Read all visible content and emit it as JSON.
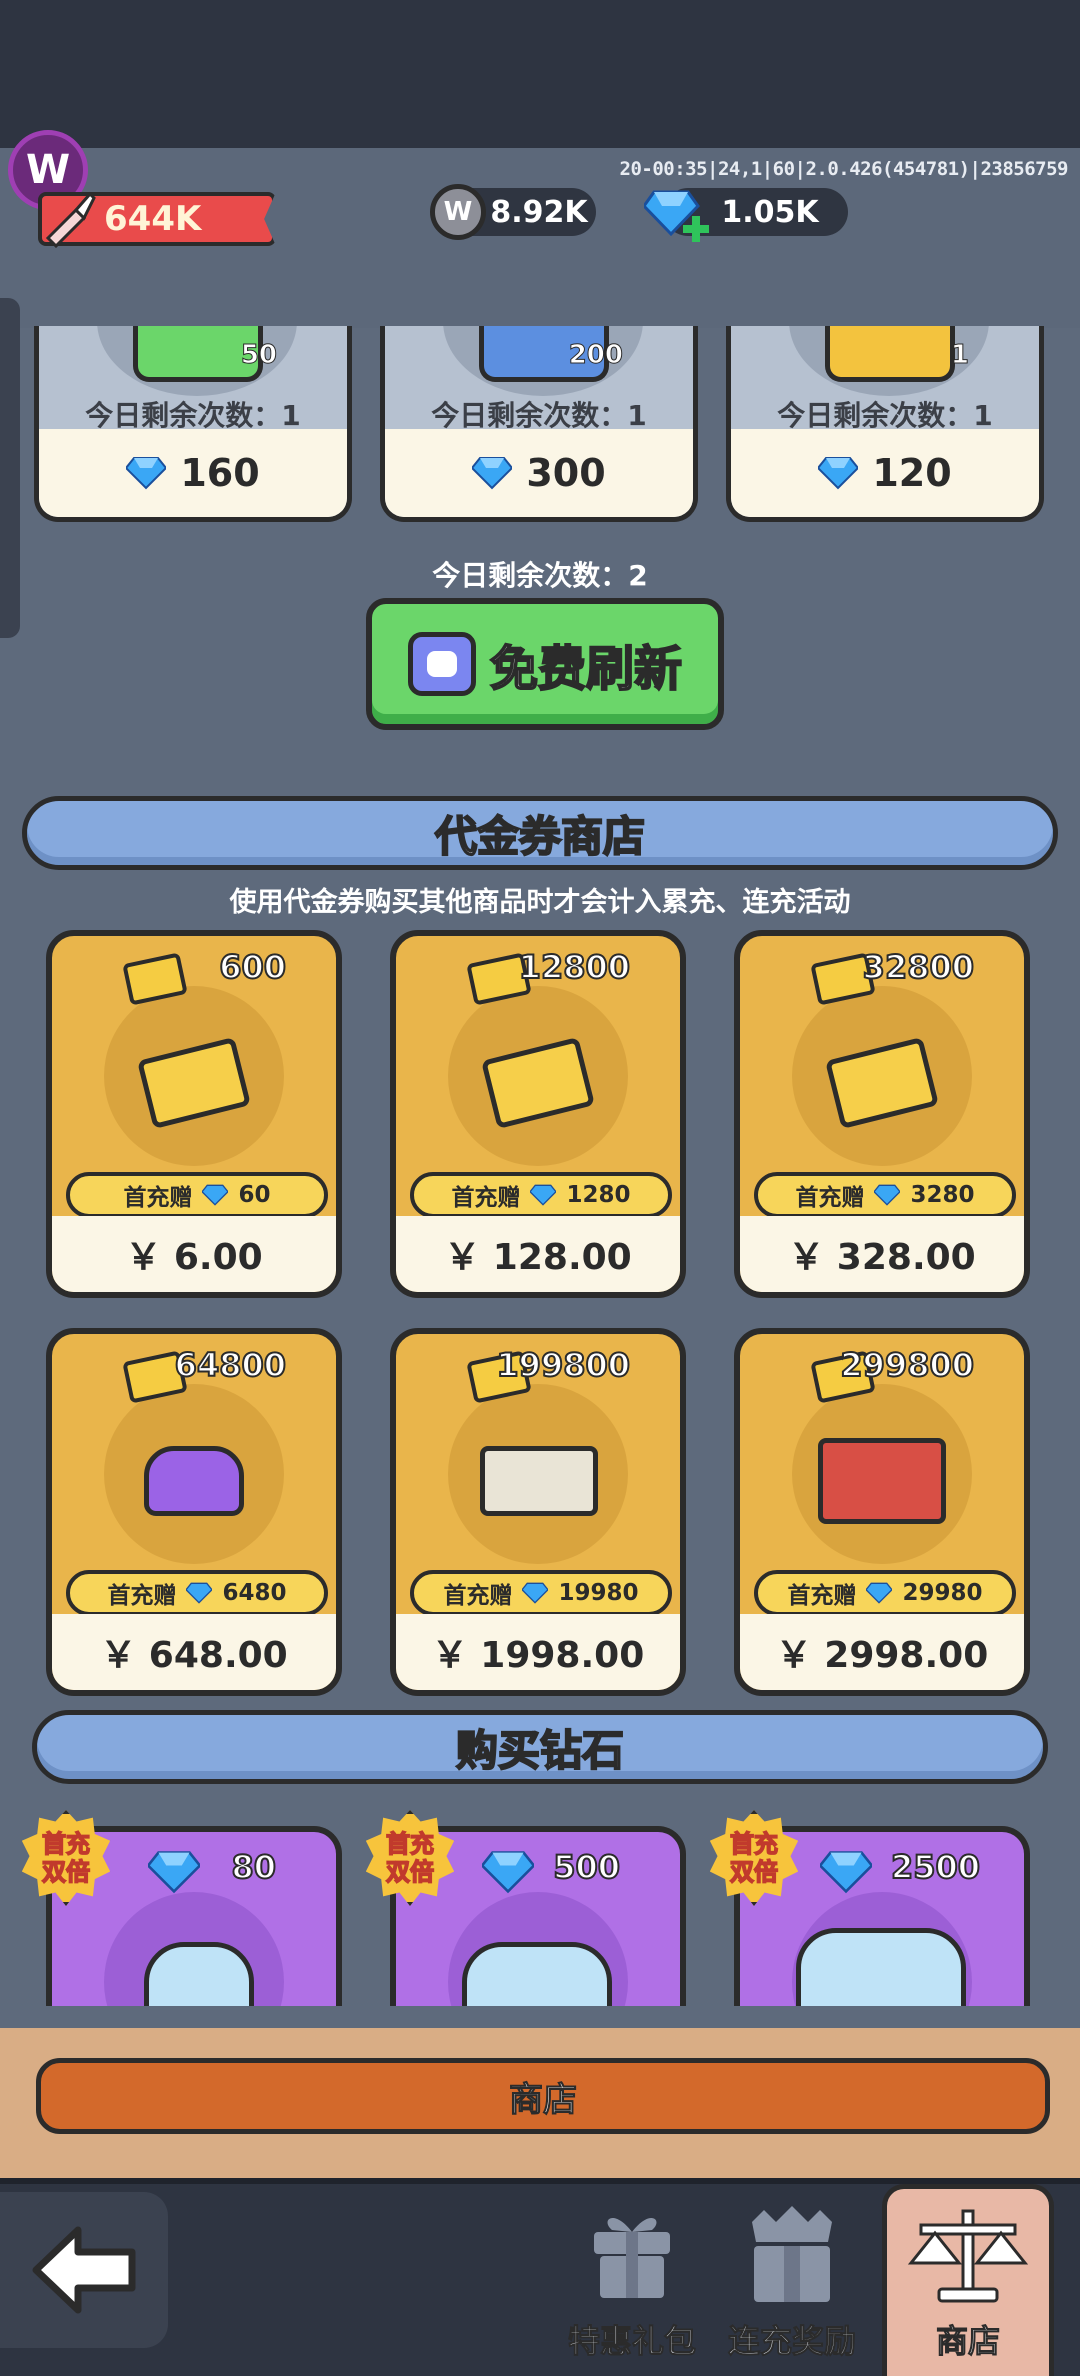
{
  "header": {
    "logo_letter": "W",
    "debug_text": "20-00:35|24,1|60|2.0.426(454781)|23856759",
    "power": "644K",
    "currency": [
      {
        "icon": "w-coin-icon",
        "value": "8.92K"
      },
      {
        "icon": "diamond-plus-icon",
        "value": "1.05K"
      }
    ]
  },
  "top_cards": [
    {
      "count": "50",
      "remaining": "今日剩余次数：1",
      "price": "160",
      "color": "#6bd66a"
    },
    {
      "count": "200",
      "remaining": "今日剩余次数：1",
      "price": "300",
      "color": "#5c8fe0"
    },
    {
      "count": "1",
      "remaining": "今日剩余次数：1",
      "price": "120",
      "color": "#f3c33e"
    }
  ],
  "refresh": {
    "remaining": "今日剩余次数：2",
    "label": "免费刷新"
  },
  "voucher_shop": {
    "title": "代金券商店",
    "subtitle": "使用代金券购买其他商品时才会计入累充、连充活动",
    "bonus_label": "首充赠",
    "items": [
      {
        "amount": "600",
        "bonus": "60",
        "price": "￥ 6.00"
      },
      {
        "amount": "12800",
        "bonus": "1280",
        "price": "￥ 128.00"
      },
      {
        "amount": "32800",
        "bonus": "3280",
        "price": "￥ 328.00"
      },
      {
        "amount": "64800",
        "bonus": "6480",
        "price": "￥ 648.00"
      },
      {
        "amount": "199800",
        "bonus": "19980",
        "price": "￥ 1998.00"
      },
      {
        "amount": "299800",
        "bonus": "29980",
        "price": "￥ 2998.00"
      }
    ]
  },
  "diamond_shop": {
    "title": "购买钻石",
    "badge_line1": "首充",
    "badge_line2": "双倍",
    "items": [
      {
        "amount": "80"
      },
      {
        "amount": "500"
      },
      {
        "amount": "2500"
      }
    ]
  },
  "panel_title": "商店",
  "nav": [
    {
      "label": "特惠礼包",
      "icon": "gift-icon"
    },
    {
      "label": "连充奖励",
      "icon": "crown-gift-icon"
    },
    {
      "label": "商店",
      "icon": "balance-scale-icon"
    }
  ],
  "colors": {
    "accent_green": "#6bd66a",
    "banner_blue": "#86a9dd",
    "voucher_gold": "#e9b54b",
    "diamond_purple": "#b070e6",
    "shop_orange": "#d3692b"
  }
}
